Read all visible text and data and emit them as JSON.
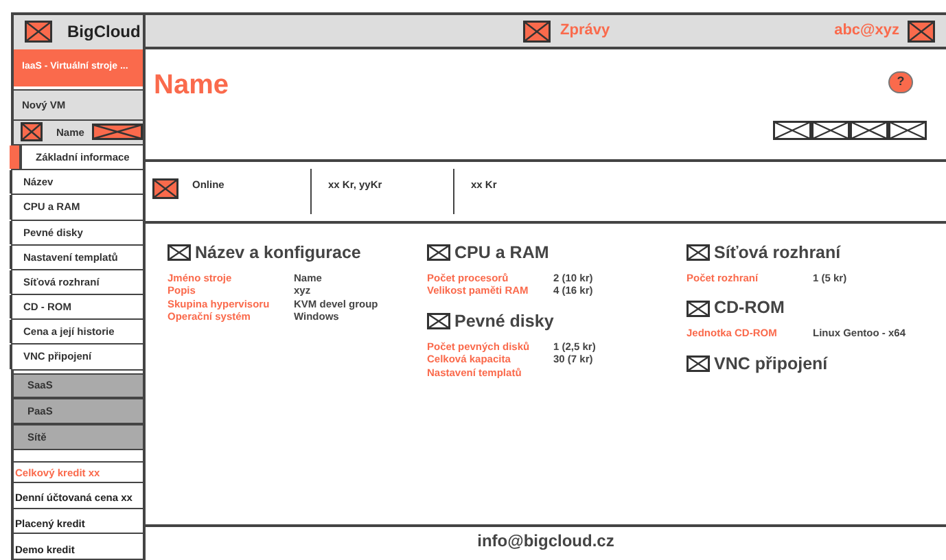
{
  "sidebar": {
    "brand": "BigCloud",
    "sections": [
      {
        "label": "IaaS - Virtuální stroje ...",
        "selected": true
      }
    ],
    "new_vm": "Nový VM",
    "vm": {
      "name": "Name",
      "items": [
        {
          "label": "Základní informace",
          "selected": true
        },
        {
          "label": "Název",
          "selected": false
        },
        {
          "label": "CPU a RAM",
          "selected": false
        },
        {
          "label": "Pevné disky",
          "selected": false
        },
        {
          "label": "Nastavení templatů",
          "selected": false
        },
        {
          "label": "Síťová rozhraní",
          "selected": false
        },
        {
          "label": "CD - ROM",
          "selected": false
        },
        {
          "label": "Cena a její historie",
          "selected": false
        },
        {
          "label": "VNC připojení",
          "selected": false
        }
      ]
    },
    "other_sections": [
      {
        "label": "SaaS",
        "selected": false
      },
      {
        "label": "PaaS",
        "selected": false
      },
      {
        "label": "Sítě",
        "selected": false
      }
    ],
    "credits": [
      {
        "label": "Celkový kredit xx",
        "kind": "total"
      },
      {
        "label": "Denní účtovaná cena xx",
        "kind": "plain"
      },
      {
        "label": "Placený kredit",
        "kind": "plain"
      },
      {
        "label": "Demo kredit",
        "kind": "plain"
      }
    ]
  },
  "header": {
    "messages": "Zprávy",
    "user": "abc@xyz"
  },
  "title": "Name",
  "help": "?",
  "status": {
    "state": "Online",
    "prices": [
      "xx Kr, yyKr",
      "xx Kr"
    ]
  },
  "columns": [
    [
      {
        "title": "Název a konfigurace",
        "rows": [
          {
            "label": "Jméno stroje",
            "value": "Name"
          },
          {
            "label": "Popis",
            "value": "xyz"
          },
          {
            "label": "Skupina hypervisoru",
            "value": "KVM devel group"
          },
          {
            "label": "Operační systém",
            "value": "Windows"
          }
        ]
      }
    ],
    [
      {
        "title": "CPU a RAM",
        "rows": [
          {
            "label": "Počet procesorů",
            "value": "2 (10 kr)"
          },
          {
            "label": "Velikost paměti RAM",
            "value": "4 (16 kr)"
          }
        ]
      },
      {
        "title": "Pevné disky",
        "rows": [
          {
            "label": "Počet pevných disků",
            "value": "1 (2,5 kr)"
          },
          {
            "label": "Celková kapacita",
            "value": "30 (7 kr)"
          },
          {
            "label": "Nastavení templatů"
          }
        ]
      }
    ],
    [
      {
        "title": "Síťová rozhraní",
        "rows": [
          {
            "label": "Počet rozhraní",
            "value": "1 (5 kr)"
          }
        ]
      },
      {
        "title": "CD-ROM",
        "rows": [
          {
            "label": "Jednotka CD-ROM",
            "value": "Linux Gentoo - x64"
          }
        ]
      },
      {
        "title": "VNC připojení"
      }
    ]
  ],
  "footer": "info@bigcloud.cz"
}
